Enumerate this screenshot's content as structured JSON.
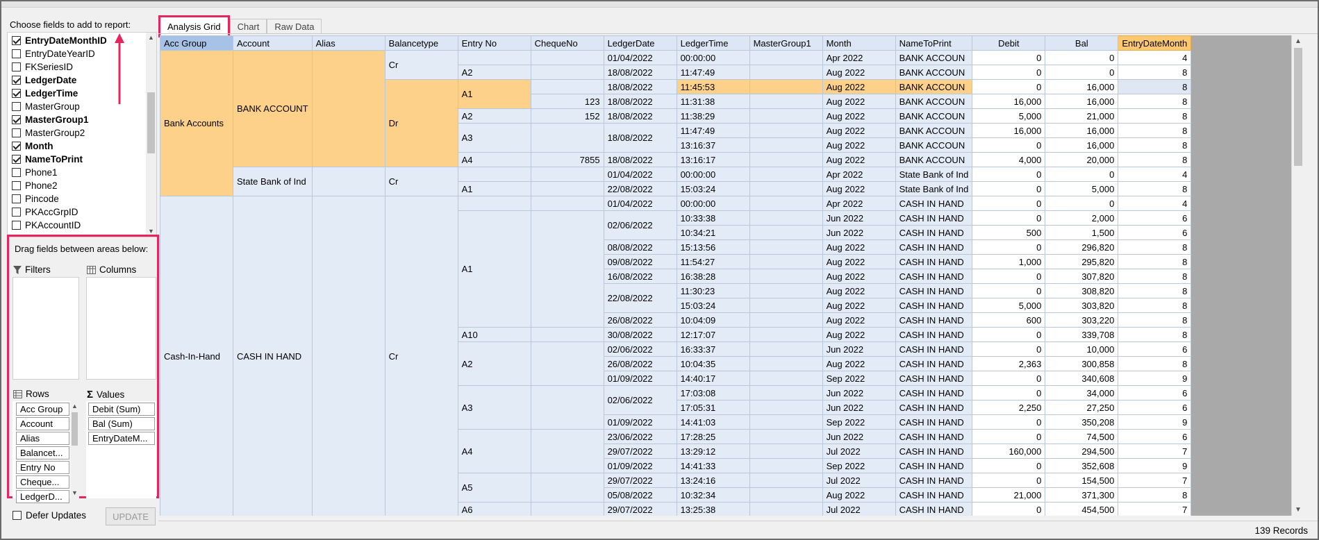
{
  "left_panel": {
    "fields_title": "Choose fields to add to report:",
    "fields": [
      {
        "label": "EntryDateMonthID",
        "checked": true
      },
      {
        "label": "EntryDateYearID",
        "checked": false
      },
      {
        "label": "FKSeriesID",
        "checked": false
      },
      {
        "label": "LedgerDate",
        "checked": true
      },
      {
        "label": "LedgerTime",
        "checked": true
      },
      {
        "label": "MasterGroup",
        "checked": false
      },
      {
        "label": "MasterGroup1",
        "checked": true
      },
      {
        "label": "MasterGroup2",
        "checked": false
      },
      {
        "label": "Month",
        "checked": true
      },
      {
        "label": "NameToPrint",
        "checked": true
      },
      {
        "label": "Phone1",
        "checked": false
      },
      {
        "label": "Phone2",
        "checked": false
      },
      {
        "label": "Pincode",
        "checked": false
      },
      {
        "label": "PKAccGrpID",
        "checked": false
      },
      {
        "label": "PKAccountID",
        "checked": false
      }
    ],
    "areas_title": "Drag fields between areas below:",
    "filters_label": "Filters",
    "columns_label": "Columns",
    "rows_label": "Rows",
    "values_label": "Values",
    "rows": [
      "Acc Group",
      "Account",
      "Alias",
      "Balancet...",
      "Entry No",
      "Cheque...",
      "LedgerD..."
    ],
    "values": [
      "Debit (Sum)",
      "Bal (Sum)",
      "EntryDateM..."
    ],
    "defer_label": "Defer Updates",
    "update_label": "UPDATE",
    "highlight_color": "#e5265c"
  },
  "tabs": [
    {
      "label": "Analysis Grid",
      "active": true
    },
    {
      "label": "Chart",
      "active": false
    },
    {
      "label": "Raw Data",
      "active": false
    }
  ],
  "grid": {
    "headers": [
      "Acc Group",
      "Account",
      "Alias",
      "Balancetype",
      "Entry No",
      "ChequeNo",
      "LedgerDate",
      "LedgerTime",
      "MasterGroup1",
      "Month",
      "NameToPrint",
      "Debit",
      "Bal",
      "EntryDateMonth"
    ],
    "groups": [
      {
        "acc_group": "Bank Accounts",
        "account": "BANK ACCOUNT",
        "name": "BANK ACCOUN",
        "cr_label": "Cr",
        "dr_label": "Dr"
      },
      {
        "account": "State Bank of Ind",
        "name": "State Bank of Ind",
        "cr_label": "Cr"
      },
      {
        "acc_group": "Cash-In-Hand",
        "account": "CASH IN HAND",
        "name": "CASH IN HAND",
        "cr_label": "Cr"
      }
    ],
    "rows": [
      {
        "entry": "",
        "cheque": "",
        "date": "01/04/2022",
        "time": "00:00:00",
        "month": "Apr 2022",
        "debit": "0",
        "bal": "0",
        "edm": "4"
      },
      {
        "entry": "A2",
        "cheque": "",
        "date": "18/08/2022",
        "time": "11:47:49",
        "month": "Aug 2022",
        "debit": "0",
        "bal": "0",
        "edm": "8"
      },
      {
        "entry": "A1",
        "cheque": "",
        "date": "18/08/2022",
        "time": "11:45:53",
        "month": "Aug 2022",
        "debit": "0",
        "bal": "16,000",
        "edm": "8"
      },
      {
        "entry": "",
        "cheque": "123",
        "date": "18/08/2022",
        "time": "11:31:38",
        "month": "Aug 2022",
        "debit": "16,000",
        "bal": "16,000",
        "edm": "8"
      },
      {
        "entry": "A2",
        "cheque": "152",
        "date": "18/08/2022",
        "time": "11:38:29",
        "month": "Aug 2022",
        "debit": "5,000",
        "bal": "21,000",
        "edm": "8"
      },
      {
        "entry": "A3",
        "cheque": "",
        "date": "18/08/2022",
        "time": "11:47:49",
        "month": "Aug 2022",
        "debit": "16,000",
        "bal": "16,000",
        "edm": "8"
      },
      {
        "entry": "",
        "cheque": "",
        "date": "",
        "time": "13:16:37",
        "month": "Aug 2022",
        "debit": "0",
        "bal": "16,000",
        "edm": "8"
      },
      {
        "entry": "A4",
        "cheque": "7855",
        "date": "18/08/2022",
        "time": "13:16:17",
        "month": "Aug 2022",
        "debit": "4,000",
        "bal": "20,000",
        "edm": "8"
      },
      {
        "entry": "",
        "cheque": "",
        "date": "01/04/2022",
        "time": "00:00:00",
        "month": "Apr 2022",
        "debit": "0",
        "bal": "0",
        "edm": "4"
      },
      {
        "entry": "A1",
        "cheque": "",
        "date": "22/08/2022",
        "time": "15:03:24",
        "month": "Aug 2022",
        "debit": "0",
        "bal": "5,000",
        "edm": "8"
      },
      {
        "entry": "",
        "cheque": "",
        "date": "01/04/2022",
        "time": "00:00:00",
        "month": "Apr 2022",
        "debit": "0",
        "bal": "0",
        "edm": "4"
      },
      {
        "entry": "A1",
        "cheque": "",
        "date": "02/06/2022",
        "time": "10:33:38",
        "month": "Jun 2022",
        "debit": "0",
        "bal": "2,000",
        "edm": "6"
      },
      {
        "entry": "",
        "cheque": "",
        "date": "",
        "time": "10:34:21",
        "month": "Jun 2022",
        "debit": "500",
        "bal": "1,500",
        "edm": "6"
      },
      {
        "entry": "",
        "cheque": "",
        "date": "08/08/2022",
        "time": "15:13:56",
        "month": "Aug 2022",
        "debit": "0",
        "bal": "296,820",
        "edm": "8"
      },
      {
        "entry": "",
        "cheque": "",
        "date": "09/08/2022",
        "time": "11:54:27",
        "month": "Aug 2022",
        "debit": "1,000",
        "bal": "295,820",
        "edm": "8"
      },
      {
        "entry": "",
        "cheque": "",
        "date": "16/08/2022",
        "time": "16:38:28",
        "month": "Aug 2022",
        "debit": "0",
        "bal": "307,820",
        "edm": "8"
      },
      {
        "entry": "",
        "cheque": "",
        "date": "22/08/2022",
        "time": "11:30:23",
        "month": "Aug 2022",
        "debit": "0",
        "bal": "308,820",
        "edm": "8"
      },
      {
        "entry": "",
        "cheque": "",
        "date": "",
        "time": "15:03:24",
        "month": "Aug 2022",
        "debit": "5,000",
        "bal": "303,820",
        "edm": "8"
      },
      {
        "entry": "",
        "cheque": "",
        "date": "26/08/2022",
        "time": "10:04:09",
        "month": "Aug 2022",
        "debit": "600",
        "bal": "303,220",
        "edm": "8"
      },
      {
        "entry": "A10",
        "cheque": "",
        "date": "30/08/2022",
        "time": "12:17:07",
        "month": "Aug 2022",
        "debit": "0",
        "bal": "339,708",
        "edm": "8"
      },
      {
        "entry": "A2",
        "cheque": "",
        "date": "02/06/2022",
        "time": "16:33:37",
        "month": "Jun 2022",
        "debit": "0",
        "bal": "10,000",
        "edm": "6"
      },
      {
        "entry": "",
        "cheque": "",
        "date": "26/08/2022",
        "time": "10:04:35",
        "month": "Aug 2022",
        "debit": "2,363",
        "bal": "300,858",
        "edm": "8"
      },
      {
        "entry": "",
        "cheque": "",
        "date": "01/09/2022",
        "time": "14:40:17",
        "month": "Sep 2022",
        "debit": "0",
        "bal": "340,608",
        "edm": "9"
      },
      {
        "entry": "A3",
        "cheque": "",
        "date": "02/06/2022",
        "time": "17:03:08",
        "month": "Jun 2022",
        "debit": "0",
        "bal": "34,000",
        "edm": "6"
      },
      {
        "entry": "",
        "cheque": "",
        "date": "",
        "time": "17:05:31",
        "month": "Jun 2022",
        "debit": "2,250",
        "bal": "27,250",
        "edm": "6"
      },
      {
        "entry": "",
        "cheque": "",
        "date": "01/09/2022",
        "time": "14:41:03",
        "month": "Sep 2022",
        "debit": "0",
        "bal": "350,208",
        "edm": "9"
      },
      {
        "entry": "A4",
        "cheque": "",
        "date": "23/06/2022",
        "time": "17:28:25",
        "month": "Jun 2022",
        "debit": "0",
        "bal": "74,500",
        "edm": "6"
      },
      {
        "entry": "",
        "cheque": "",
        "date": "29/07/2022",
        "time": "13:29:12",
        "month": "Jul 2022",
        "debit": "160,000",
        "bal": "294,500",
        "edm": "7"
      },
      {
        "entry": "",
        "cheque": "",
        "date": "01/09/2022",
        "time": "14:41:33",
        "month": "Sep 2022",
        "debit": "0",
        "bal": "352,608",
        "edm": "9"
      },
      {
        "entry": "A5",
        "cheque": "",
        "date": "29/07/2022",
        "time": "13:24:16",
        "month": "Jul 2022",
        "debit": "0",
        "bal": "154,500",
        "edm": "7"
      },
      {
        "entry": "",
        "cheque": "",
        "date": "05/08/2022",
        "time": "10:32:34",
        "month": "Aug 2022",
        "debit": "21,000",
        "bal": "371,300",
        "edm": "8"
      },
      {
        "entry": "A6",
        "cheque": "",
        "date": "29/07/2022",
        "time": "13:25:38",
        "month": "Jul 2022",
        "debit": "0",
        "bal": "454,500",
        "edm": "7"
      }
    ]
  },
  "status": {
    "records": "139 Records"
  },
  "colors": {
    "highlight": "#fdd18a",
    "header_hl": "#fdc870",
    "annotation": "#e5265c"
  }
}
